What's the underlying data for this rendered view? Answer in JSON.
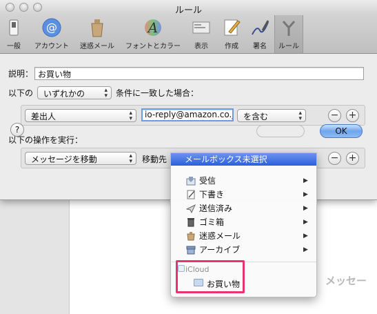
{
  "window": {
    "title": "ルール"
  },
  "toolbar": {
    "items": [
      {
        "label": "一般",
        "icon": "switch-icon"
      },
      {
        "label": "アカウント",
        "icon": "at-icon"
      },
      {
        "label": "迷惑メール",
        "icon": "trash-bag-icon"
      },
      {
        "label": "フォントとカラー",
        "icon": "font-icon"
      },
      {
        "label": "表示",
        "icon": "display-icon"
      },
      {
        "label": "作成",
        "icon": "compose-icon"
      },
      {
        "label": "署名",
        "icon": "signature-icon"
      },
      {
        "label": "ルール",
        "icon": "rules-icon"
      }
    ]
  },
  "form": {
    "description_label": "説明：",
    "description_value": "お買い物",
    "condition_prefix": "以下の",
    "condition_select": "いずれかの",
    "condition_suffix": "条件に一致した場合：",
    "rule": {
      "field_select": "差出人",
      "value": "io-reply@amazon.co.jp",
      "operator_select": "を含む",
      "minus": "−",
      "plus": "+"
    },
    "actions_label": "以下の操作を実行：",
    "action": {
      "select": "メッセージを移動",
      "target_label": "移動先",
      "minus": "−",
      "plus": "+"
    },
    "help": "?",
    "ok": "OK"
  },
  "menu": {
    "header": "メールボックス未選択",
    "items": [
      {
        "label": "受信",
        "icon": "inbox-icon"
      },
      {
        "label": "下書き",
        "icon": "drafts-icon"
      },
      {
        "label": "送信済み",
        "icon": "sent-icon"
      },
      {
        "label": "ゴミ箱",
        "icon": "trash-icon"
      },
      {
        "label": "迷惑メール",
        "icon": "junk-icon"
      },
      {
        "label": "アーカイブ",
        "icon": "archive-icon"
      }
    ],
    "icloud_header": "iCloud",
    "icloud_folder": "お買い物"
  },
  "background": {
    "partial_text": "メッセー"
  },
  "colors": {
    "highlight": "#e8336f",
    "menu_selected": "#3a6de0",
    "ok_button": "#6ea5ee"
  }
}
